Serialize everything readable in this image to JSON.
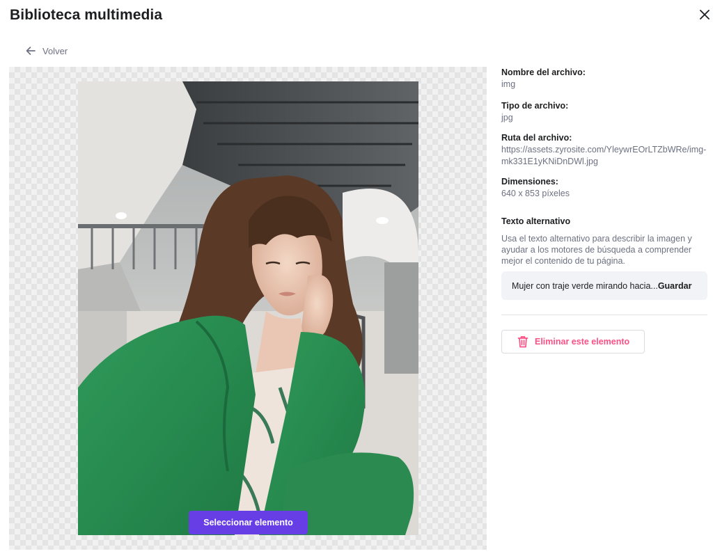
{
  "dialog": {
    "title": "Biblioteca multimedia"
  },
  "nav": {
    "back_label": "Volver"
  },
  "preview": {
    "select_label": "Seleccionar elemento"
  },
  "file": {
    "name_label": "Nombre del archivo:",
    "name_value": "img",
    "type_label": "Tipo de archivo:",
    "type_value": "jpg",
    "path_label": "Ruta del archivo:",
    "path_value": "https://assets.zyrosite.com/YleywrEOrLTZbWRe/img-mk331E1yKNiDnDWl.jpg",
    "dimensions_label": "Dimensiones:",
    "dimensions_value": "640 x 853 píxeles"
  },
  "alt_text": {
    "title": "Texto alternativo",
    "description": "Usa el texto alternativo para describir la imagen y ayudar a los motores de búsqueda a comprender mejor el contenido de tu página.",
    "value": "Mujer con traje verde mirando hacia...",
    "save_label": "Guardar"
  },
  "actions": {
    "delete_label": "Eliminar este elemento"
  },
  "colors": {
    "accent": "#673de6",
    "danger": "#fc5185",
    "text": "#1d1e20",
    "muted": "#6d7081"
  },
  "icons": {
    "close": "close-icon",
    "back": "arrow-left-icon",
    "delete": "trash-icon"
  }
}
